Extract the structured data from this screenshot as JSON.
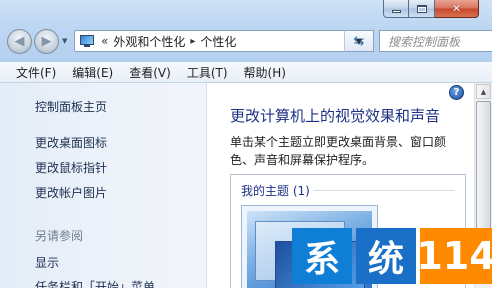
{
  "window": {
    "caption": {
      "minimize": "_",
      "maximize": "□",
      "close": "✕"
    }
  },
  "nav": {
    "back_icon": "back-arrow-icon",
    "forward_icon": "forward-arrow-icon"
  },
  "address": {
    "overflow": "«",
    "breadcrumbs": [
      "外观和个性化",
      "个性化"
    ],
    "separator": "▸"
  },
  "search": {
    "placeholder": "搜索控制面板"
  },
  "menu": [
    "文件(F)",
    "编辑(E)",
    "查看(V)",
    "工具(T)",
    "帮助(H)"
  ],
  "sidebar": {
    "items": [
      "控制面板主页",
      "更改桌面图标",
      "更改鼠标指针",
      "更改帐户图片"
    ],
    "see_also": "另请参阅",
    "see_also_items": [
      "显示",
      "任务栏和「开始」菜单"
    ]
  },
  "main": {
    "help": "?",
    "title": "更改计算机上的视觉效果和声音",
    "description": "单击某个主题立即更改桌面背景、窗口颜色、声音和屏幕保护程序。",
    "themes_group_label": "我的主题 (1)"
  },
  "watermark": {
    "chars": [
      "系",
      "统",
      "114"
    ]
  },
  "colors": {
    "accent_title": "#1e3287",
    "logo_blue": "#0f7fd6",
    "logo_orange": "#ff8a00"
  }
}
